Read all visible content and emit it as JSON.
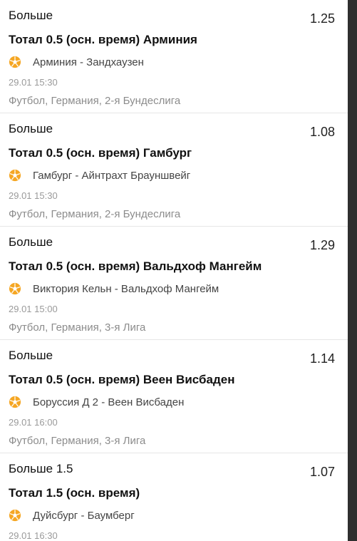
{
  "bets": [
    {
      "outcome": "Больше",
      "odds": "1.25",
      "market": "Тотал 0.5 (осн. время)  Арминия",
      "match": "Арминия - Зандхаузен",
      "time": "29.01 15:30",
      "league": "Футбол, Германия, 2-я Бундеслига",
      "icon": "soccer-ball-icon"
    },
    {
      "outcome": "Больше",
      "odds": "1.08",
      "market": "Тотал 0.5 (осн. время)  Гамбург",
      "match": "Гамбург - Айнтрахт Брауншвейг",
      "time": "29.01 15:30",
      "league": "Футбол, Германия, 2-я Бундеслига",
      "icon": "soccer-ball-icon"
    },
    {
      "outcome": "Больше",
      "odds": "1.29",
      "market": "Тотал 0.5 (осн. время)  Вальдхоф Мангейм",
      "match": "Виктория Кельн - Вальдхоф Мангейм",
      "time": "29.01 15:00",
      "league": "Футбол, Германия, 3-я Лига",
      "icon": "soccer-ball-icon"
    },
    {
      "outcome": "Больше",
      "odds": "1.14",
      "market": "Тотал 0.5 (осн. время)  Веен Висбаден",
      "match": "Боруссия Д 2 - Веен Висбаден",
      "time": "29.01 16:00",
      "league": "Футбол, Германия, 3-я Лига",
      "icon": "soccer-ball-icon"
    },
    {
      "outcome": "Больше 1.5",
      "odds": "1.07",
      "market": "Тотал 1.5 (осн. время)",
      "match": "Дуйсбург - Баумберг",
      "time": "29.01 16:30",
      "league": "",
      "icon": "soccer-ball-icon"
    }
  ],
  "colors": {
    "ball_orange": "#f5a623",
    "background": "#ffffff",
    "divider": "#e6e6e6"
  }
}
